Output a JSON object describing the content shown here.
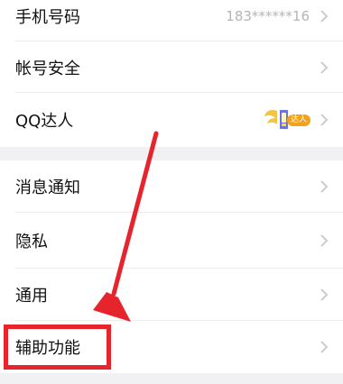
{
  "settings": {
    "phone": {
      "label": "手机号码",
      "value": "183******16"
    },
    "account_security": {
      "label": "帐号安全"
    },
    "qq_talent": {
      "label": "QQ达人",
      "badge_text": "达人"
    },
    "notifications": {
      "label": "消息通知"
    },
    "privacy": {
      "label": "隐私"
    },
    "general": {
      "label": "通用"
    },
    "accessibility": {
      "label": "辅助功能"
    }
  },
  "colors": {
    "text": "#111111",
    "secondary_text": "#b5b5b5",
    "section_gap": "#f1f1f3",
    "divider": "#ececec",
    "annotation_red": "#e5242b",
    "badge_orange": "#f3a21b"
  },
  "icons": {
    "chevron": "chevron-right-icon",
    "qq_talent": "qq-talent-badge-icon"
  }
}
